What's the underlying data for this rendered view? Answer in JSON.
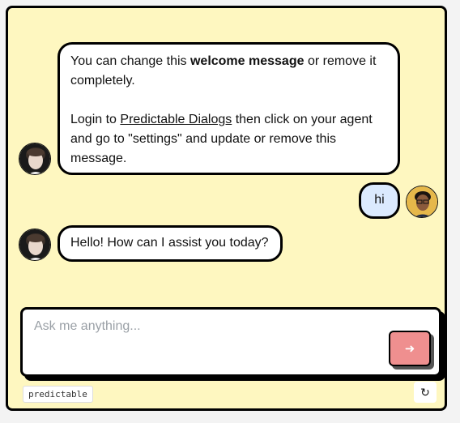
{
  "messages": [
    {
      "role": "bot",
      "avatar_icon": "bot-avatar-icon",
      "para1_part1": "You can change this ",
      "para1_bold": "welcome message",
      "para1_part2": " or remove it completely.",
      "para2_part1": "Login to ",
      "para2_link": "Predictable Dialogs",
      "para2_part2": " then click on your agent and go to \"settings\" and update or remove this message."
    },
    {
      "role": "user",
      "avatar_icon": "user-avatar-icon",
      "text": "hi"
    },
    {
      "role": "bot",
      "avatar_icon": "bot-avatar-icon",
      "text": "Hello! How can I assist you today?"
    }
  ],
  "input": {
    "placeholder": "Ask me anything...",
    "value": "",
    "send_icon": "arrow-right-icon"
  },
  "footer": {
    "brand_label": "predictable",
    "refresh_icon": "refresh-icon"
  },
  "colors": {
    "background": "#fef7c0",
    "bot_bubble": "#ffffff",
    "user_bubble": "#dbeafe",
    "send_button": "#ef8f8f",
    "border": "#000000"
  }
}
